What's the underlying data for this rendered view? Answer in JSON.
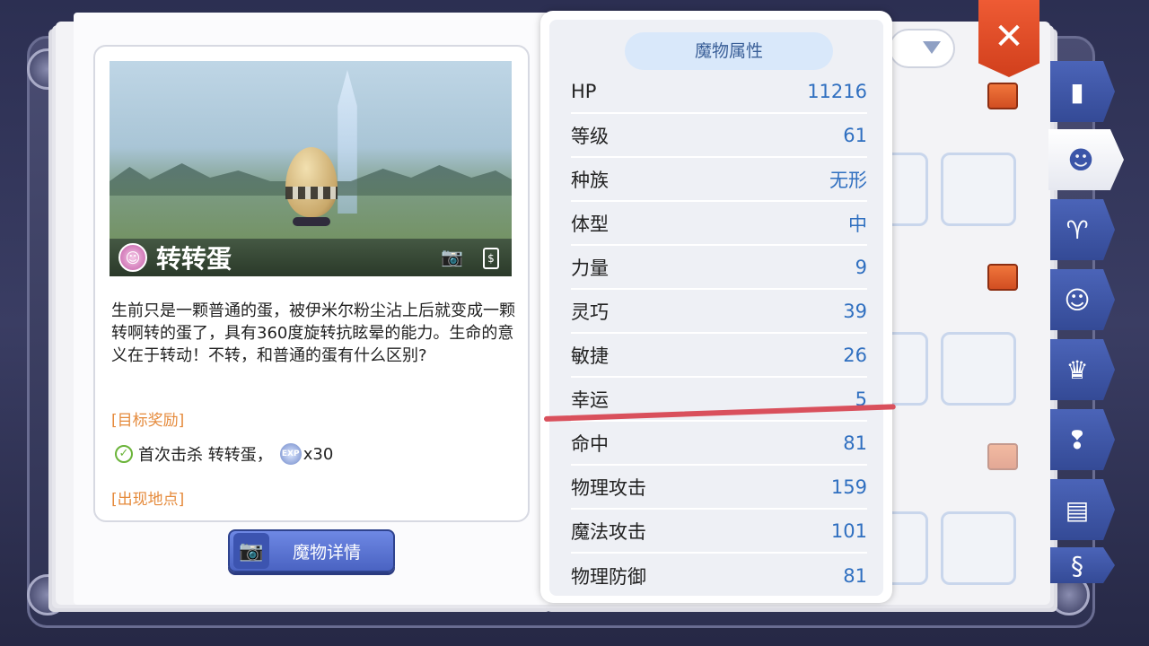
{
  "monster": {
    "name": "转转蛋",
    "description": "生前只是一颗普通的蛋，被伊米尔粉尘沾上后就变成一颗转啊转的蛋了，具有360度旋转抗眩晕的能力。生命的意义在于转动！不转，和普通的蛋有什么区别?",
    "type_icon": "ghost-badge-icon"
  },
  "rewards": {
    "title": "[目标奖励]",
    "first_kill": "首次击杀 转转蛋，",
    "exp_amount": "x30",
    "exp_icon_text": "EXP"
  },
  "locations": {
    "title": "[出现地点]"
  },
  "detail_button": {
    "label": "魔物详情"
  },
  "stats": {
    "header": "魔物属性",
    "rows": [
      {
        "label": "HP",
        "value": "11216"
      },
      {
        "label": "等级",
        "value": "61"
      },
      {
        "label": "种族",
        "value": "无形"
      },
      {
        "label": "体型",
        "value": "中"
      },
      {
        "label": "力量",
        "value": "9"
      },
      {
        "label": "灵巧",
        "value": "39"
      },
      {
        "label": "敏捷",
        "value": "26"
      },
      {
        "label": "幸运",
        "value": "5"
      },
      {
        "label": "命中",
        "value": "81"
      },
      {
        "label": "物理攻击",
        "value": "159"
      },
      {
        "label": "魔法攻击",
        "value": "101"
      },
      {
        "label": "物理防御",
        "value": "81"
      }
    ]
  },
  "close": {
    "label": "✕"
  },
  "colors": {
    "accent": "#2f6fc0",
    "section": "#e58a3b",
    "close": "#e0502a",
    "annotation": "#d9505c"
  }
}
